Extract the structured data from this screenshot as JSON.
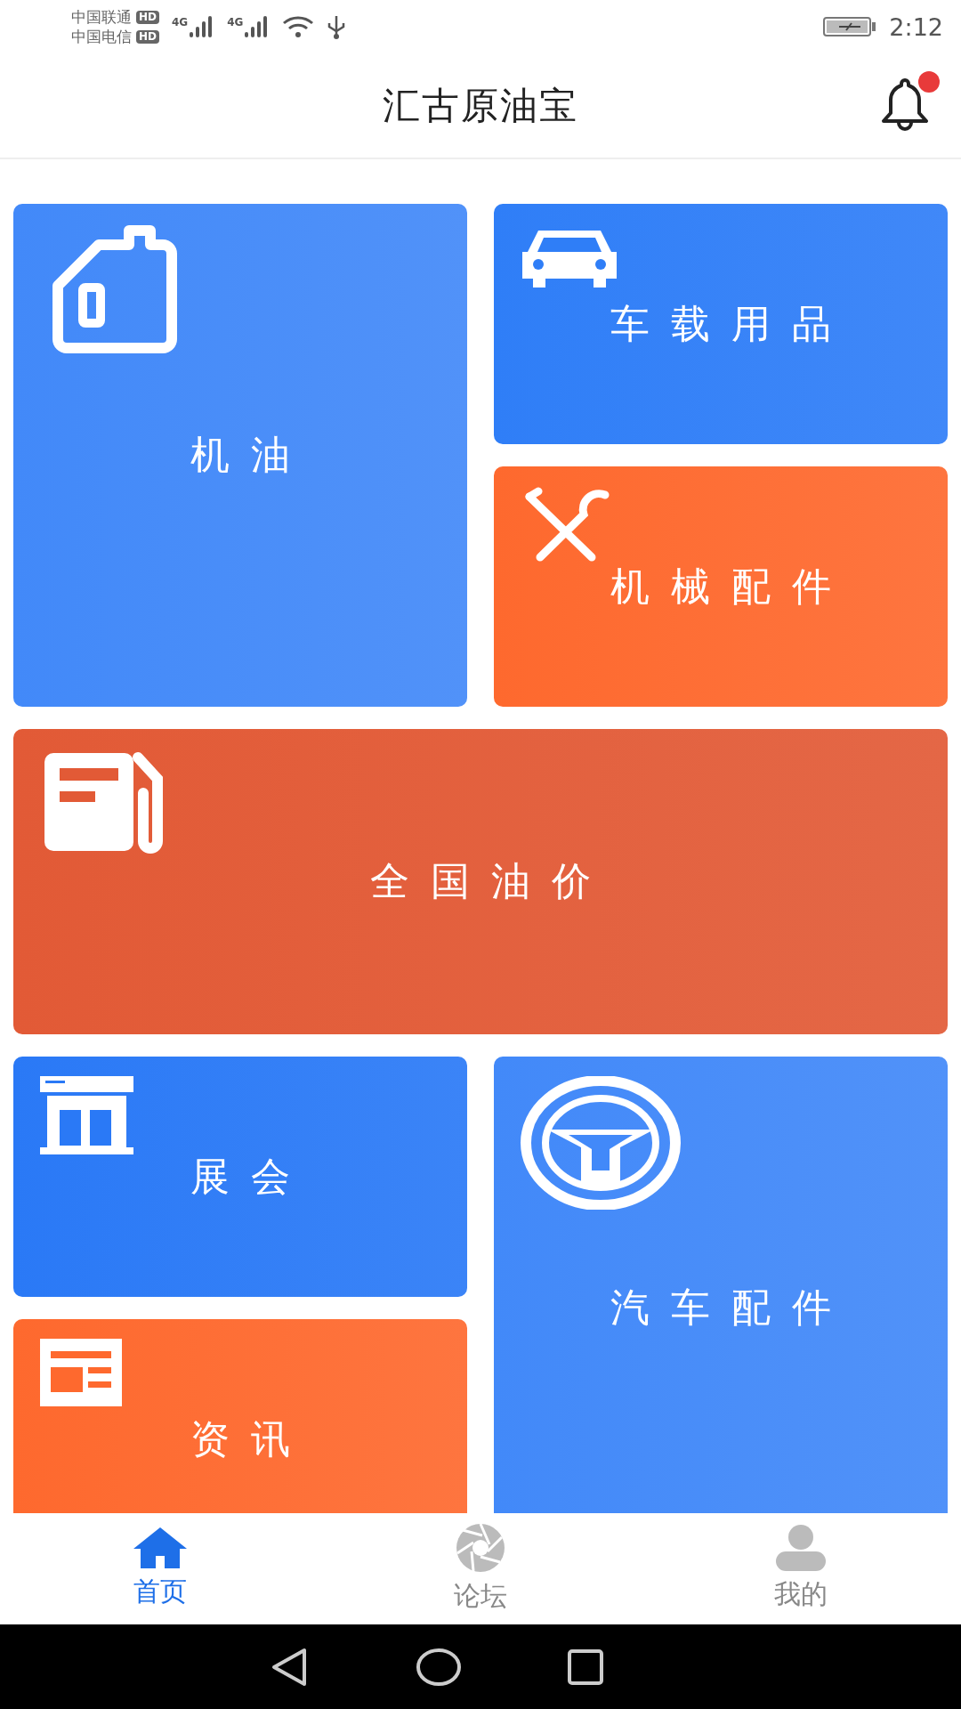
{
  "status_bar": {
    "carriers": [
      {
        "name": "中国联通",
        "badge": "HD"
      },
      {
        "name": "中国电信",
        "badge": "HD"
      }
    ],
    "networks": [
      "4G",
      "4G"
    ],
    "time": "2:12"
  },
  "header": {
    "title": "汇古原油宝",
    "notification_dot": true
  },
  "tiles": [
    {
      "label": "机油",
      "kind": "oil-can",
      "color": "#4289f9"
    },
    {
      "label": "车载用品",
      "kind": "car",
      "color": "#2f7ef7"
    },
    {
      "label": "机械配件",
      "kind": "tools",
      "color": "#fe692e"
    },
    {
      "label": "全国油价",
      "kind": "fuel-pump",
      "color": "#e25a36"
    },
    {
      "label": "展会",
      "kind": "exhibition",
      "color": "#2a79f6"
    },
    {
      "label": "汽车配件",
      "kind": "steering-wheel",
      "color": "#4289f9"
    },
    {
      "label": "资讯",
      "kind": "news",
      "color": "#fe692e"
    }
  ],
  "bottom_nav": [
    {
      "label": "首页",
      "kind": "home",
      "selected": true
    },
    {
      "label": "论坛",
      "kind": "aperture",
      "selected": false
    },
    {
      "label": "我的",
      "kind": "person",
      "selected": false
    }
  ]
}
